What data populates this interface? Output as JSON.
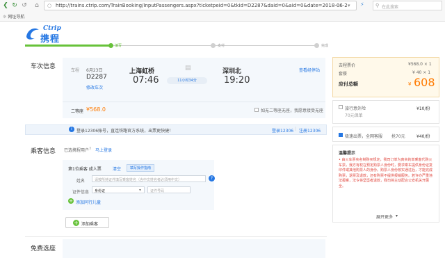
{
  "browser": {
    "url": "http://trains.ctrip.com/TrainBooking/InputPassengers.aspx?ticketpeid=0&tkid=D2287&daid=0&aid=0&date=2018-06-2",
    "search_placeholder": "在此搜索",
    "favorites": "网址导航"
  },
  "logo": {
    "en": "Ctrip",
    "cn": "携程"
  },
  "progress": {
    "steps": [
      "填写",
      "支付",
      "完成"
    ]
  },
  "train": {
    "section_title": "车次信息",
    "label": "车程",
    "date": "6月23日",
    "number": "D2287",
    "change_link": "修改车次",
    "from_station": "上海虹桥",
    "depart_time": "07:46",
    "duration": "11小时34分",
    "to_station": "深圳北",
    "arrive_time": "19:20",
    "timetable_link": "查看经停站",
    "seat_type": "二等座",
    "seat_price": "¥568.0",
    "seat_note": "如无二等座无座，我愿意接受无座"
  },
  "notice": {
    "text": "登录12306账号，直连铁路官方系统，出票更快捷！",
    "login_link": "登录12306",
    "register_link": "注册12306"
  },
  "passenger": {
    "section_title": "乘客信息",
    "selected_label": "已选携程用户",
    "login_link": "马上登录",
    "row_label": "第1位乘客 成人票",
    "clear_link": "清空",
    "help_link": "填写操作指南",
    "name_label": "姓名",
    "name_placeholder": "请按所持证件填写乘客姓名（含中文姓名者必须用中文）",
    "id_label": "证件信息",
    "id_type": "身份证",
    "id_placeholder": "证件号码",
    "add_child": "添加同行儿童",
    "add_passenger": "添加乘客"
  },
  "free_section": {
    "section_title": "免费选座"
  },
  "price": {
    "ticket_label": "去程票价",
    "ticket_value": "¥568.0 × 1",
    "service_label": "套餐",
    "service_value": "¥ 40 × 1",
    "total_label": "应付总额",
    "total_value": "608",
    "currency": "¥"
  },
  "insurance": {
    "name": "旅行意外险",
    "desc": "70元保单",
    "price": "¥10/份"
  },
  "package": {
    "name": "极速出票，全网客服",
    "desc": "抢70元",
    "price": "¥40/份"
  },
  "tips": {
    "title": "温馨提示",
    "text": "• 由火车票实名制购买规定，我司订单为真实的单乘客代购火车票，我方有权在预定购票人身份时，要求乘车提供身份证复印件或其他购票人的身份。购票人身份核实通过后，才能完成购票，退票及退款，还有购票不提供报销服务。若许办严重违法报乘，法令将坚坚者退款，我司将主动配合公安机关开展全。",
    "more": "展开更多"
  },
  "colors": {
    "accent": "#2577e3",
    "price": "#ff7a00",
    "progress": "#67c23a"
  }
}
